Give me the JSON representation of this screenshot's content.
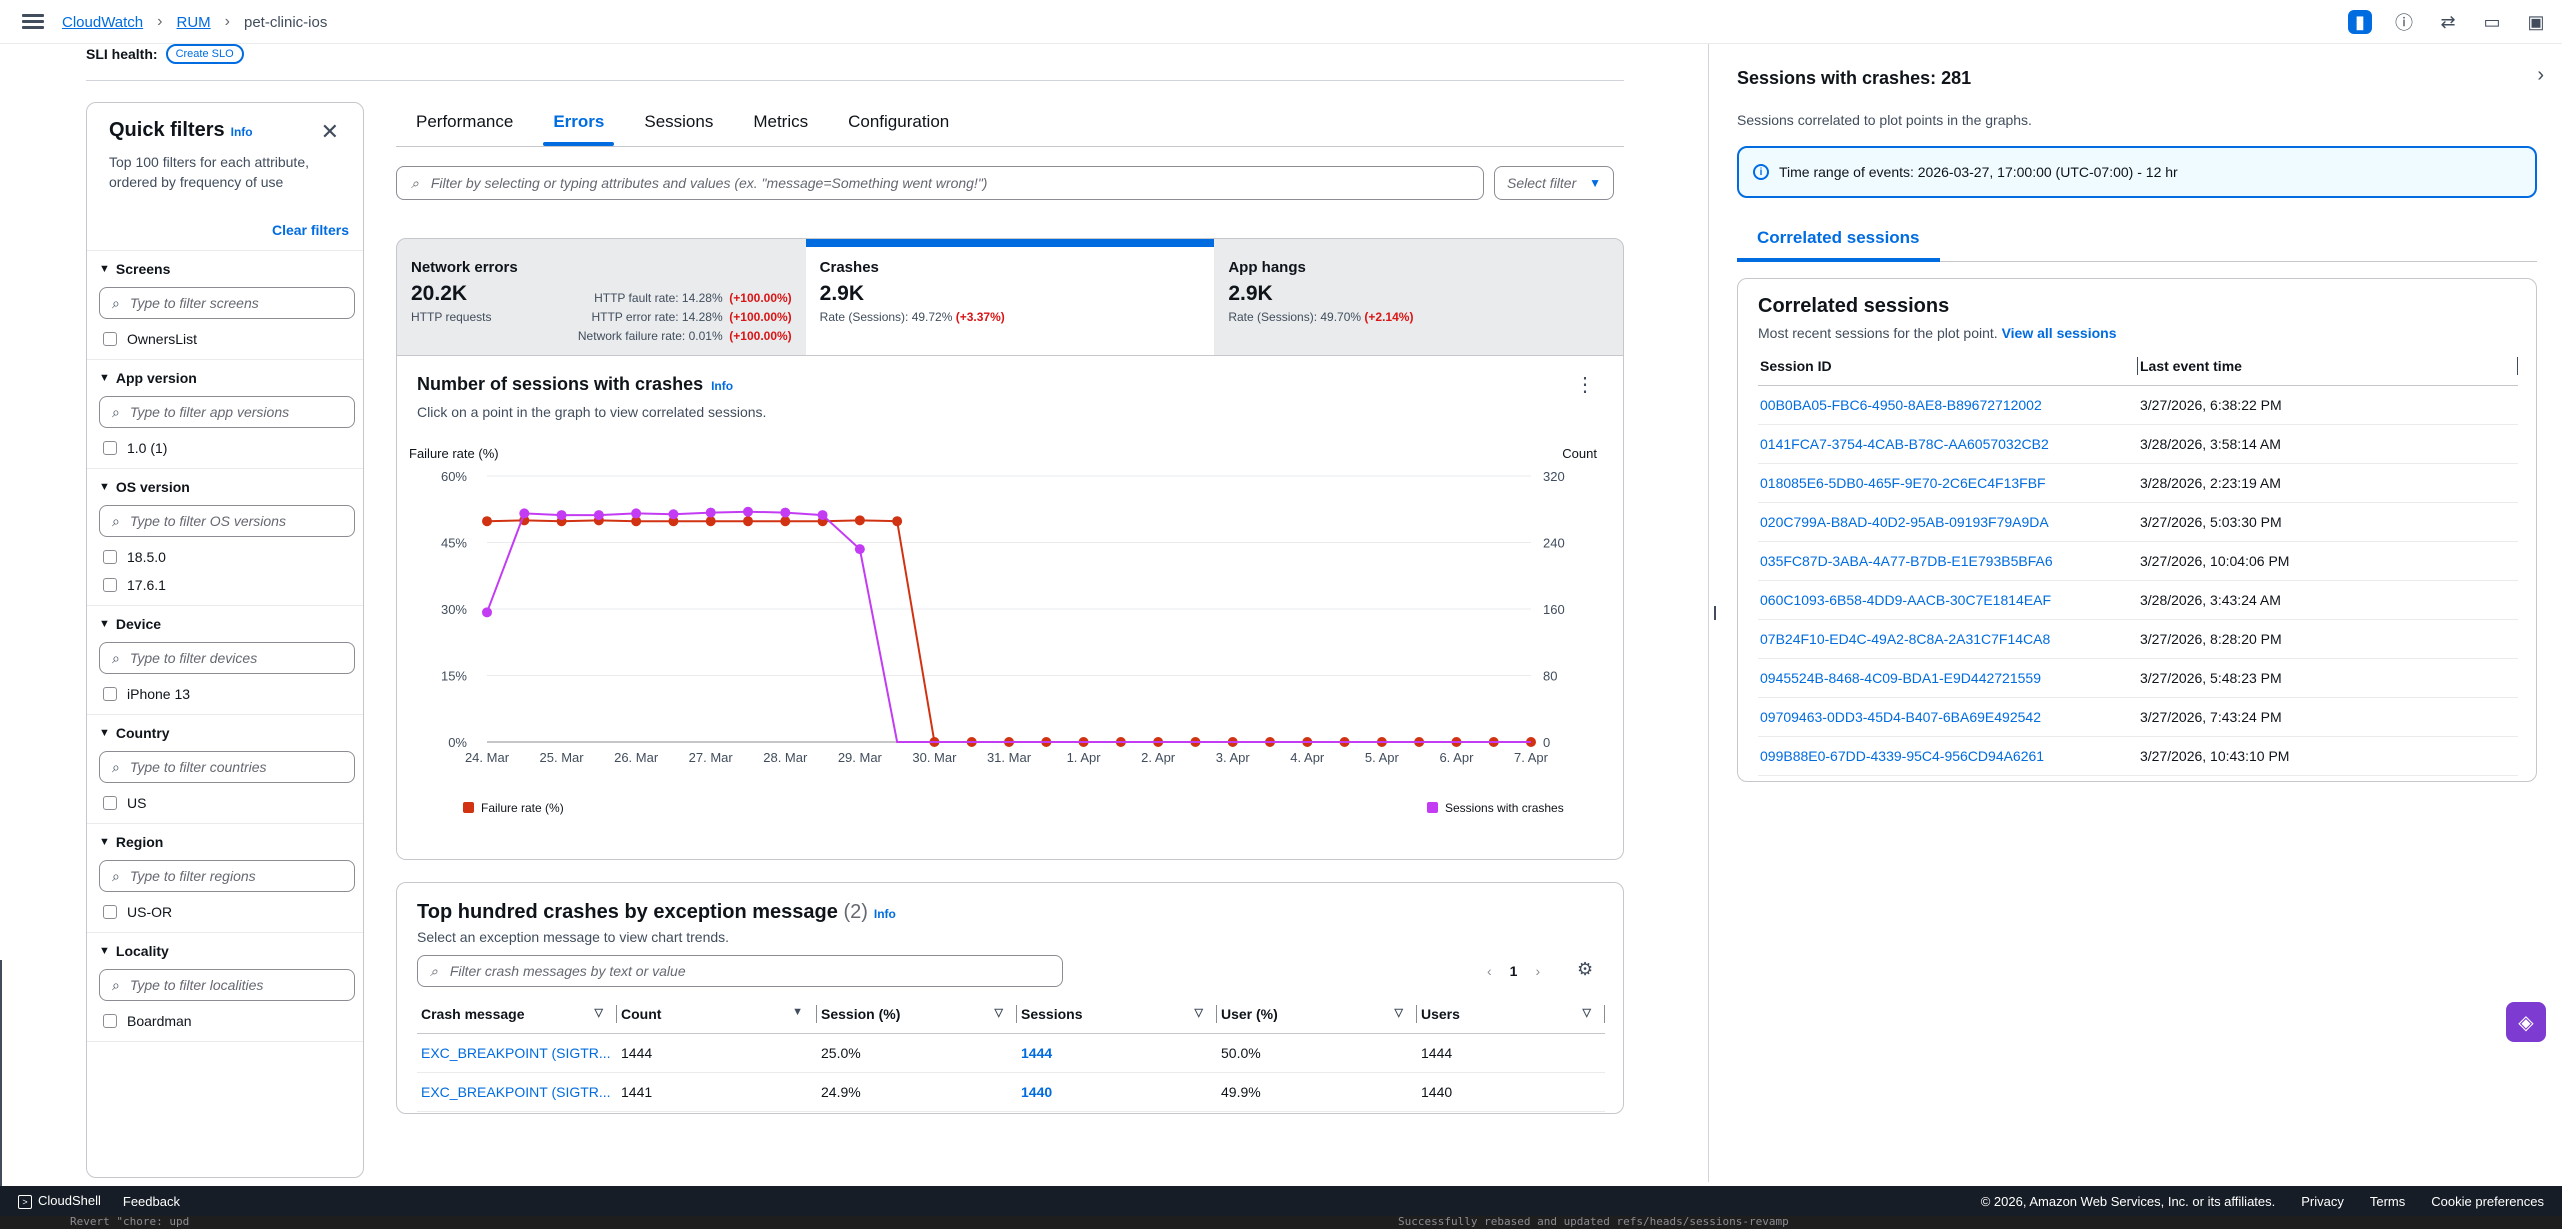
{
  "breadcrumb": [
    "CloudWatch",
    "RUM",
    "pet-clinic-ios"
  ],
  "sli": {
    "label": "SLI health:",
    "button": "Create SLO"
  },
  "quick_filters": {
    "title": "Quick filters",
    "info": "Info",
    "description": "Top 100 filters for each attribute, ordered by frequency of use",
    "clear": "Clear filters",
    "sections": [
      {
        "title": "Screens",
        "placeholder": "Type to filter screens",
        "options": [
          "OwnersList"
        ]
      },
      {
        "title": "App version",
        "placeholder": "Type to filter app versions",
        "options": [
          "1.0 (1)"
        ]
      },
      {
        "title": "OS version",
        "placeholder": "Type to filter OS versions",
        "options": [
          "18.5.0",
          "17.6.1"
        ]
      },
      {
        "title": "Device",
        "placeholder": "Type to filter devices",
        "options": [
          "iPhone 13"
        ]
      },
      {
        "title": "Country",
        "placeholder": "Type to filter countries",
        "options": [
          "US"
        ]
      },
      {
        "title": "Region",
        "placeholder": "Type to filter regions",
        "options": [
          "US-OR"
        ]
      },
      {
        "title": "Locality",
        "placeholder": "Type to filter localities",
        "options": [
          "Boardman"
        ]
      }
    ]
  },
  "tabs": [
    "Performance",
    "Errors",
    "Sessions",
    "Metrics",
    "Configuration"
  ],
  "active_tab": "Errors",
  "filter_placeholder": "Filter by selecting or typing attributes and values (ex. \"message=Something went wrong!\")",
  "select_filter": "Select filter",
  "metrics": {
    "network": {
      "title": "Network errors",
      "value": "20.2K",
      "sub": "HTTP requests",
      "lines": [
        {
          "label": "HTTP fault rate: 14.28%",
          "delta": "(+100.00%)"
        },
        {
          "label": "HTTP error rate: 14.28%",
          "delta": "(+100.00%)"
        },
        {
          "label": "Network failure rate: 0.01%",
          "delta": "(+100.00%)"
        }
      ]
    },
    "crashes": {
      "title": "Crashes",
      "value": "2.9K",
      "sub": "Rate (Sessions): 49.72%",
      "delta": "(+3.37%)"
    },
    "hangs": {
      "title": "App hangs",
      "value": "2.9K",
      "sub": "Rate (Sessions): 49.70%",
      "delta": "(+2.14%)"
    }
  },
  "chart_card": {
    "title": "Number of sessions with crashes",
    "info": "Info",
    "subtitle": "Click on a point in the graph to view correlated sessions."
  },
  "chart_data": {
    "type": "line",
    "ylabel_left": "Failure rate (%)",
    "ylabel_right": "Count",
    "y_left_ticks": [
      "60%",
      "45%",
      "30%",
      "15%",
      "0%"
    ],
    "y_right_ticks": [
      "320",
      "240",
      "160",
      "80",
      "0"
    ],
    "x_tick_labels": [
      "24. Mar",
      "25. Mar",
      "26. Mar",
      "27. Mar",
      "28. Mar",
      "29. Mar",
      "30. Mar",
      "31. Mar",
      "1. Apr",
      "2. Apr",
      "3. Apr",
      "4. Apr",
      "5. Apr",
      "6. Apr",
      "7. Apr"
    ],
    "ylim_left": [
      0,
      60
    ],
    "ylim_right": [
      0,
      320
    ],
    "x_count": 29,
    "series": [
      {
        "name": "Failure rate (%)",
        "axis": "left",
        "color": "#d13212",
        "values": [
          49.8,
          50,
          49.8,
          50,
          49.8,
          49.8,
          49.8,
          49.8,
          49.8,
          49.8,
          50,
          49.8,
          0,
          0,
          0,
          0,
          0,
          0,
          0,
          0,
          0,
          0,
          0,
          0,
          0,
          0,
          0,
          0,
          0
        ]
      },
      {
        "name": "Sessions with crashes",
        "axis": "right",
        "color": "#c33cf3",
        "values": [
          156,
          275,
          273,
          273,
          275,
          274,
          276,
          277,
          276,
          273,
          232,
          0,
          0,
          0,
          0,
          0,
          0,
          0,
          0,
          0,
          0,
          0,
          0,
          0,
          0,
          0,
          0,
          0,
          0
        ]
      }
    ],
    "legend": [
      "Failure rate (%)",
      "Sessions with crashes"
    ]
  },
  "crashes_table": {
    "title": "Top hundred crashes by exception message",
    "count": "(2)",
    "info": "Info",
    "subtitle": "Select an exception message to view chart trends.",
    "filter_placeholder": "Filter crash messages by text or value",
    "page": "1",
    "columns": [
      "Crash message",
      "Count",
      "Session (%)",
      "Sessions",
      "User (%)",
      "Users"
    ],
    "rows": [
      [
        "EXC_BREAKPOINT (SIGTR...",
        "1444",
        "25.0%",
        "1444",
        "50.0%",
        "1444"
      ],
      [
        "EXC_BREAKPOINT (SIGTR...",
        "1441",
        "24.9%",
        "1440",
        "49.9%",
        "1440"
      ]
    ]
  },
  "right_panel": {
    "title": "Sessions with crashes: 281",
    "description": "Sessions correlated to plot points in the graphs.",
    "alert": "Time range of events: 2026-03-27, 17:00:00 (UTC-07:00) - 12 hr",
    "tab": "Correlated sessions",
    "card_title": "Correlated sessions",
    "card_sub": "Most recent sessions for the plot point.",
    "view_all": "View all sessions",
    "columns": [
      "Session ID",
      "Last event time"
    ],
    "rows": [
      [
        "00B0BA05-FBC6-4950-8AE8-B89672712002",
        "3/27/2026, 6:38:22 PM"
      ],
      [
        "0141FCA7-3754-4CAB-B78C-AA6057032CB2",
        "3/28/2026, 3:58:14 AM"
      ],
      [
        "018085E6-5DB0-465F-9E70-2C6EC4F13FBF",
        "3/28/2026, 2:23:19 AM"
      ],
      [
        "020C799A-B8AD-40D2-95AB-09193F79A9DA",
        "3/27/2026, 5:03:30 PM"
      ],
      [
        "035FC87D-3ABA-4A77-B7DB-E1E793B5BFA6",
        "3/27/2026, 10:04:06 PM"
      ],
      [
        "060C1093-6B58-4DD9-AACB-30C7E1814EAF",
        "3/28/2026, 3:43:24 AM"
      ],
      [
        "07B24F10-ED4C-49A2-8C8A-2A31C7F14CA8",
        "3/27/2026, 8:28:20 PM"
      ],
      [
        "0945524B-8468-4C09-BDA1-E9D442721559",
        "3/27/2026, 5:48:23 PM"
      ],
      [
        "09709463-0DD3-45D4-B407-6BA69E492542",
        "3/27/2026, 7:43:24 PM"
      ],
      [
        "099B88E0-67DD-4339-95C4-956CD94A6261",
        "3/27/2026, 10:43:10 PM"
      ]
    ]
  },
  "footer": {
    "left": [
      "CloudShell",
      "Feedback"
    ],
    "copyright": "© 2026, Amazon Web Services, Inc. or its affiliates.",
    "right": [
      "Privacy",
      "Terms",
      "Cookie preferences"
    ]
  },
  "bottom_strip": {
    "left": "Revert \"chore: upd",
    "right": "Successfully rebased and updated refs/heads/sessions-revamp"
  },
  "colors": {
    "accent": "#006ce0",
    "failure": "#d13212",
    "sessions": "#c33cf3",
    "delta": "#d91515"
  }
}
